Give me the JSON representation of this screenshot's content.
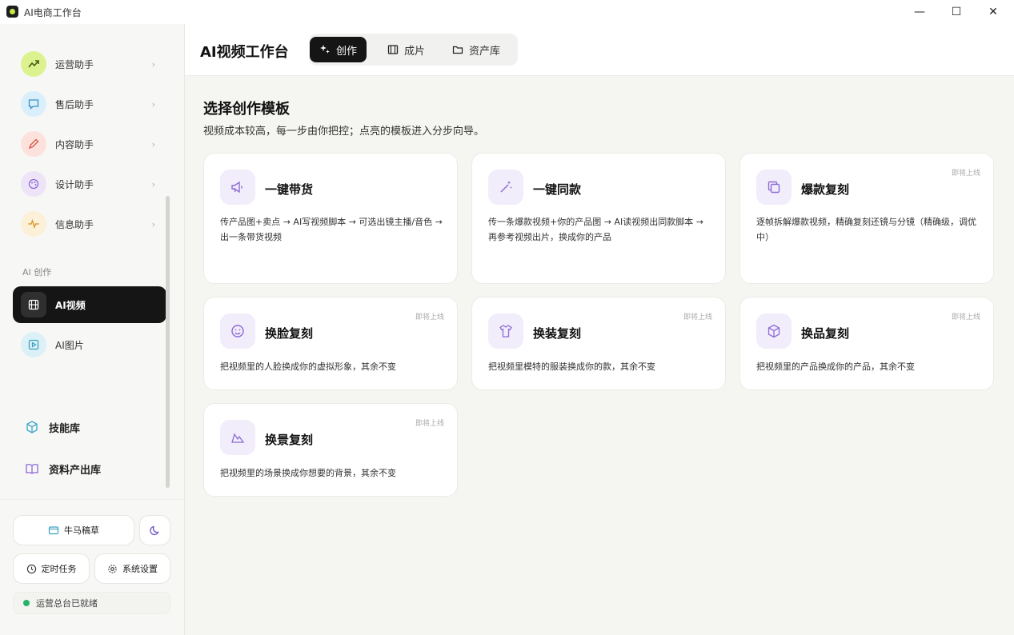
{
  "window": {
    "title": "AI电商工作台",
    "controls": {
      "minimize": "—",
      "maximize": "☐",
      "close": "✕"
    }
  },
  "sidebar": {
    "assistants": [
      {
        "label": "运营助手",
        "icon": "trend-up-icon",
        "color": "#d9f28a"
      },
      {
        "label": "售后助手",
        "icon": "chat-bubble-icon",
        "color": "#d7eefb"
      },
      {
        "label": "内容助手",
        "icon": "pen-icon",
        "color": "#fde0dc"
      },
      {
        "label": "设计助手",
        "icon": "palette-icon",
        "color": "#ece3f8"
      },
      {
        "label": "信息助手",
        "icon": "pulse-icon",
        "color": "#fdefd6"
      }
    ],
    "section_label": "AI 创作",
    "create_items": [
      {
        "label": "AI视频",
        "icon": "film-icon",
        "active": true
      },
      {
        "label": "AI图片",
        "icon": "image-play-icon",
        "active": false
      }
    ],
    "libraries": [
      {
        "label": "技能库",
        "icon": "cube-icon"
      },
      {
        "label": "资料产出库",
        "icon": "book-open-icon"
      }
    ],
    "footer": {
      "draft_button": "牛马稿草",
      "timer_button": "定时任务",
      "settings_button": "系统设置",
      "status_text": "运营总台已就绪"
    }
  },
  "header": {
    "title": "AI视频工作台",
    "tabs": [
      {
        "label": "创作",
        "icon": "sparkle-icon",
        "active": true
      },
      {
        "label": "成片",
        "icon": "film-strip-icon",
        "active": false
      },
      {
        "label": "资产库",
        "icon": "folder-icon",
        "active": false
      }
    ]
  },
  "main": {
    "section_title": "选择创作模板",
    "section_subtitle": "视频成本较高，每一步由你把控；点亮的模板进入分步向导。",
    "cards": [
      {
        "title": "一键带货",
        "desc": "传产品图+卖点 → AI写视频脚本 → 可选出镜主播/音色 → 出一条带货视频",
        "badge": "",
        "icon": "megaphone-icon"
      },
      {
        "title": "一键同款",
        "desc": "传一条爆款视频+你的产品图 → AI读视频出同款脚本 → 再参考视频出片，换成你的产品",
        "badge": "",
        "icon": "magic-wand-icon"
      },
      {
        "title": "爆款复刻",
        "desc": "逐帧拆解爆款视频，精确复刻还镜与分镜（精确级，调优中）",
        "badge": "即将上线",
        "icon": "copy-icon"
      },
      {
        "title": "换脸复刻",
        "desc": "把视频里的人脸换成你的虚拟形象，其余不变",
        "badge": "即将上线",
        "icon": "smile-icon"
      },
      {
        "title": "换装复刻",
        "desc": "把视频里模特的服装换成你的款，其余不变",
        "badge": "即将上线",
        "icon": "shirt-icon"
      },
      {
        "title": "换品复刻",
        "desc": "把视频里的产品换成你的产品，其余不变",
        "badge": "即将上线",
        "icon": "box-icon"
      },
      {
        "title": "换景复刻",
        "desc": "把视频里的场景换成你想要的背景，其余不变",
        "badge": "即将上线",
        "icon": "mountain-icon"
      }
    ]
  },
  "colors": {
    "accent_dark": "#151515",
    "icon_purple": "#8e6bd6",
    "status_green": "#28b36a"
  }
}
